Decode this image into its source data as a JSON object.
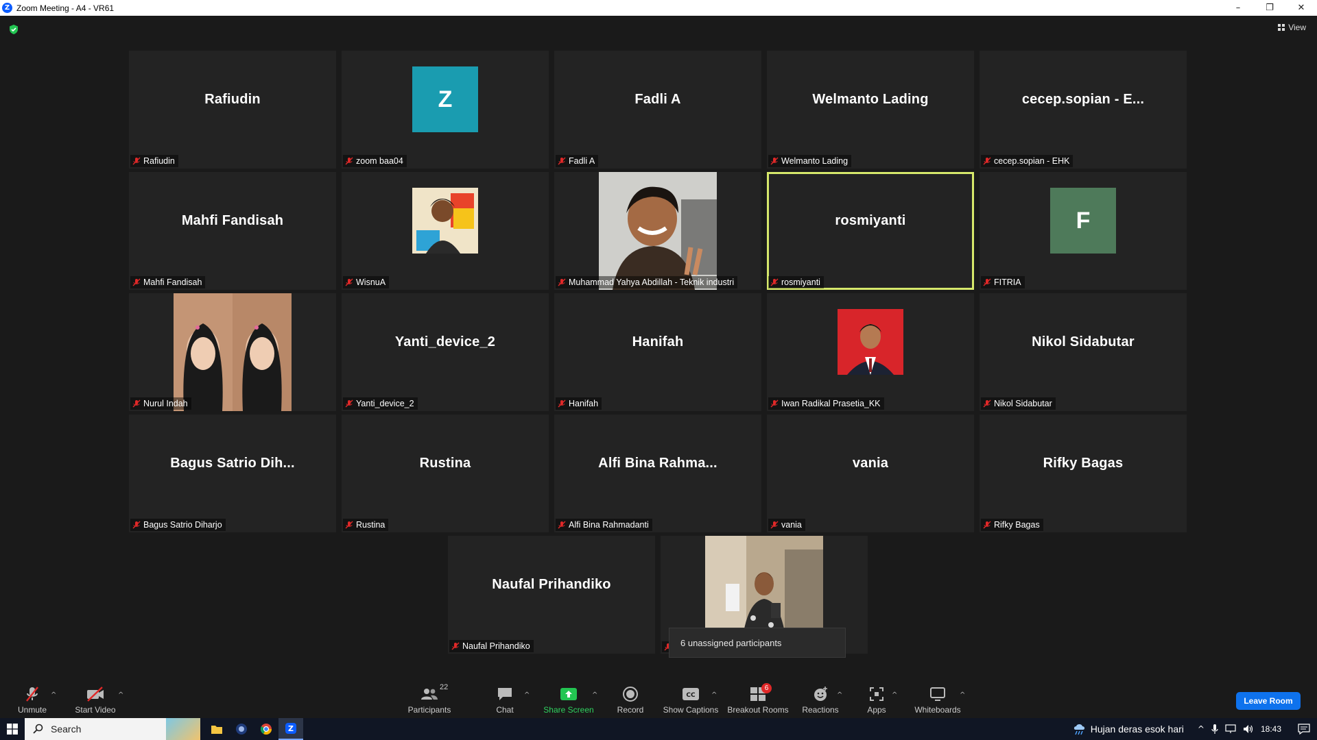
{
  "window": {
    "title": "Zoom Meeting - A4 - VR61",
    "min": "–",
    "restore": "❐",
    "close": "✕"
  },
  "view": {
    "label": "View"
  },
  "colors": {
    "accent": "#0e72ed",
    "active_speaker": "#d6e86b",
    "share_green": "#2fd25f",
    "badge_red": "#e02828"
  },
  "tiles": [
    {
      "display": "Rafiudin",
      "label": "Rafiudin",
      "kind": "name"
    },
    {
      "display": "Z",
      "label": "zoom baa04",
      "kind": "letter",
      "color": "#1a9cb0"
    },
    {
      "display": "Fadli A",
      "label": "Fadli A",
      "kind": "name"
    },
    {
      "display": "Welmanto Lading",
      "label": "Welmanto Lading",
      "kind": "name"
    },
    {
      "display": "cecep.sopian - E...",
      "label": "cecep.sopian - EHK",
      "kind": "name"
    },
    {
      "display": "Mahfi Fandisah",
      "label": "Mahfi Fandisah",
      "kind": "name"
    },
    {
      "display": "",
      "label": "WisnuA",
      "kind": "photo"
    },
    {
      "display": "",
      "label": "Muhammad Yahya Abdillah - Teknik industri",
      "kind": "video"
    },
    {
      "display": "rosmiyanti",
      "label": "rosmiyanti",
      "kind": "name",
      "active": true
    },
    {
      "display": "F",
      "label": "FITRIA",
      "kind": "letter",
      "color": "#4e7a5a"
    },
    {
      "display": "",
      "label": "Nurul Indah",
      "kind": "video"
    },
    {
      "display": "Yanti_device_2",
      "label": "Yanti_device_2",
      "kind": "name"
    },
    {
      "display": "Hanifah",
      "label": "Hanifah",
      "kind": "name"
    },
    {
      "display": "",
      "label": "Iwan Radikal Prasetia_KK",
      "kind": "photo"
    },
    {
      "display": "Nikol Sidabutar",
      "label": "Nikol Sidabutar",
      "kind": "name"
    },
    {
      "display": "Bagus Satrio Dih...",
      "label": "Bagus Satrio Diharjo",
      "kind": "name"
    },
    {
      "display": "Rustina",
      "label": "Rustina",
      "kind": "name"
    },
    {
      "display": "Alfi Bina Rahma...",
      "label": "Alfi Bina Rahmadanti",
      "kind": "name"
    },
    {
      "display": "vania",
      "label": "vania",
      "kind": "name"
    },
    {
      "display": "Rifky Bagas",
      "label": "Rifky Bagas",
      "kind": "name"
    }
  ],
  "last_row": [
    {
      "display": "Naufal Prihandiko",
      "label": "Naufal Prihandiko",
      "kind": "name"
    },
    {
      "display": "",
      "label": "",
      "kind": "video"
    }
  ],
  "tooltip": {
    "text": "6 unassigned participants"
  },
  "toolbar": {
    "unmute": "Unmute",
    "start_video": "Start Video",
    "participants": "Participants",
    "participants_count": "22",
    "chat": "Chat",
    "share_screen": "Share Screen",
    "record": "Record",
    "captions": "Show Captions",
    "breakout": "Breakout Rooms",
    "breakout_badge": "6",
    "reactions": "Reactions",
    "apps": "Apps",
    "whiteboards": "Whiteboards",
    "leave": "Leave Room"
  },
  "taskbar": {
    "search_placeholder": "Search",
    "weather": "Hujan deras esok hari",
    "time": "18:43"
  }
}
